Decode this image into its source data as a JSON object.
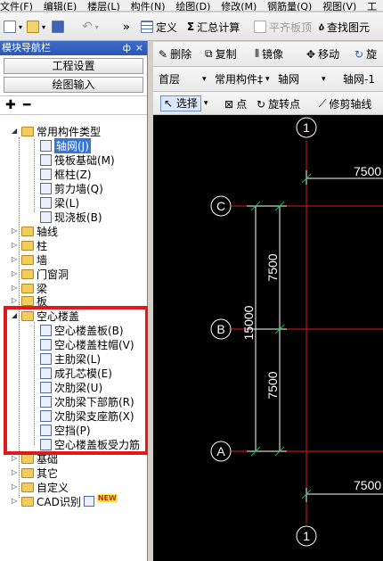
{
  "menu": [
    "文件(F)",
    "编辑(E)",
    "楼层(L)",
    "构件(N)",
    "绘图(D)",
    "修改(M)",
    "钢筋量(Q)",
    "视图(V)",
    "工"
  ],
  "toolbar": {
    "define": "定义",
    "summary_calc": "汇总计算",
    "flat_slab_top": "平齐板顶",
    "find_element": "查找图元"
  },
  "edit_bar": {
    "delete": "删除",
    "copy": "复制",
    "mirror": "镜像",
    "move": "移动",
    "rotate": "旋"
  },
  "filter_bar": {
    "floor": "首层",
    "component_type": "常用构件‡",
    "category": "轴网",
    "item": "轴网-1"
  },
  "draw_bar": {
    "select": "选择",
    "point": "点",
    "rotate_point": "旋转点",
    "trim_axis": "修剪轴线"
  },
  "panel": {
    "title": "模块导航栏",
    "pin": "ф",
    "close": "×",
    "project_settings": "工程设置",
    "drawing_input": "绘图输入",
    "tool_add": "✚",
    "tool_remove": "━"
  },
  "tree": {
    "common": "常用构件类型",
    "common_items": [
      "轴网(J)",
      "筏板基础(M)",
      "框柱(Z)",
      "剪力墙(Q)",
      "梁(L)",
      "现浇板(B)"
    ],
    "mid_folders": [
      "轴线",
      "柱",
      "墙",
      "门窗洞",
      "梁",
      "板"
    ],
    "hollow": "空心楼盖",
    "hollow_items": [
      "空心楼盖板(B)",
      "空心楼盖柱帽(V)",
      "主肋梁(L)",
      "成孔芯模(E)",
      "次肋梁(U)",
      "次肋梁下部筋(R)",
      "次肋梁支座筋(X)",
      "空挡(P)",
      "空心楼盖板受力筋"
    ],
    "bottom_folders": [
      "基础",
      "其它",
      "自定义",
      "CAD识别"
    ],
    "new_badge": "NEW"
  },
  "cad": {
    "axis_top": "1",
    "axis_bottom": "1",
    "axis_c": "C",
    "axis_b": "B",
    "axis_a": "A",
    "dim_top": "7500",
    "dim_bottom": "7500",
    "dim_cb": "7500",
    "dim_ba": "7500",
    "dim_total": "15000"
  },
  "colors": {
    "highlight_box": "#e0191a",
    "axis_line": "#e0191a",
    "dimension": "#ffffff",
    "marker": "#00c94a",
    "selection": "#3874d8"
  }
}
